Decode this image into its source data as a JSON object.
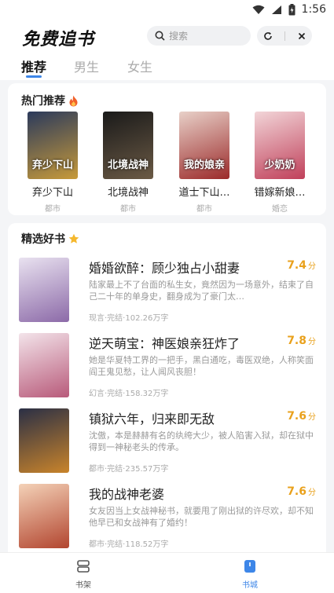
{
  "status_bar": {
    "time": "1:56"
  },
  "header": {
    "title": "免费追书",
    "search_placeholder": "搜索"
  },
  "tabs": [
    {
      "label": "推荐",
      "active": true
    },
    {
      "label": "男生",
      "active": false
    },
    {
      "label": "女生",
      "active": false
    }
  ],
  "hot": {
    "title": "热门推荐",
    "icon": "fire-icon",
    "items": [
      {
        "name": "弃少下山",
        "category": "都市",
        "cover_text": "弃少下山",
        "color_a": "#2b3a5c",
        "color_b": "#c79a3a"
      },
      {
        "name": "北境战神",
        "category": "都市",
        "cover_text": "北境战神",
        "color_a": "#1a1a1a",
        "color_b": "#6b5a45"
      },
      {
        "name": "道士下山…",
        "category": "都市",
        "cover_text": "我的娘亲",
        "color_a": "#e8d0c8",
        "color_b": "#9b2a2a"
      },
      {
        "name": "错嫁新娘…",
        "category": "婚恋",
        "cover_text": "少奶奶",
        "color_a": "#f2d5d8",
        "color_b": "#c0405a"
      }
    ]
  },
  "picks": {
    "title": "精选好书",
    "icon": "star-icon",
    "score_unit": "分",
    "books": [
      {
        "title": "婚婚欲醉：顾少独占小甜妻",
        "score": "7.4",
        "desc": "陆家最上不了台面的私生女，竟然因为一场意外，结束了自己二十年的单身史，翻身成为了豪门太…",
        "meta": "现言·完结·102.26万字",
        "color_a": "#e9e2f0",
        "color_b": "#8c6aa8"
      },
      {
        "title": "逆天萌宝：神医娘亲狂炸了",
        "score": "7.8",
        "desc": "她是华夏特工界的一把手，黑白通吃，毒医双绝，人称笑面阎王鬼见愁，让人闻风丧胆！",
        "meta": "幻言·完结·158.32万字",
        "color_a": "#f3e4ea",
        "color_b": "#b85a7a"
      },
      {
        "title": "镇狱六年，归来即无敌",
        "score": "7.6",
        "desc": "沈傲，本是赫赫有名的纨绔大少，被人陷害入狱，却在狱中得到一神秘老头的传承。",
        "meta": "都市·完结·235.57万字",
        "color_a": "#2a2f45",
        "color_b": "#c9842b"
      },
      {
        "title": "我的战神老婆",
        "score": "7.6",
        "desc": "女友因当上女战神秘书，就要甩了刚出狱的许尽欢，却不知他早已和女战神有了婚约！",
        "meta": "都市·完结·118.52万字",
        "color_a": "#f4d2b8",
        "color_b": "#b2452f"
      }
    ]
  },
  "bottom_nav": [
    {
      "label": "书架",
      "icon": "bookshelf-icon",
      "active": false
    },
    {
      "label": "书城",
      "icon": "bookstore-icon",
      "active": true
    }
  ]
}
